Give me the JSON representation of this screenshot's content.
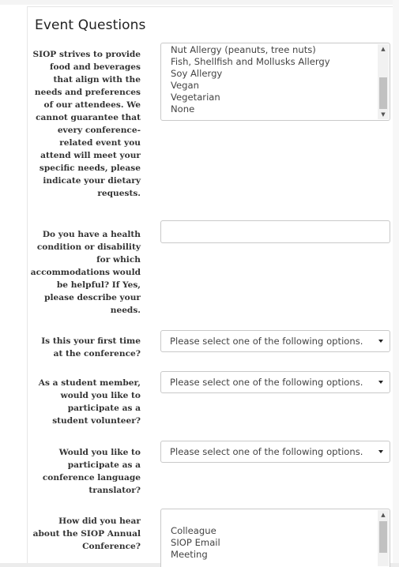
{
  "form": {
    "title": "Event Questions",
    "questions": {
      "dietary": {
        "label": "SIOP strives to provide food and beverages that align with the needs and preferences of our attendees. We cannot guarantee that every conference-related event you attend will meet your specific needs, please indicate your dietary requests.",
        "options": [
          "Nut Allergy (peanuts, tree nuts)",
          "Fish, Shellfish and Mollusks Allergy",
          "Soy Allergy",
          "Vegan",
          "Vegetarian",
          "None"
        ]
      },
      "health": {
        "label": "Do you have a health condition or disability for which accommodations would be helpful? If Yes, please describe your needs.",
        "value": ""
      },
      "first_time": {
        "label": "Is this your first time at the conference?",
        "selected": "Please select one of the following options."
      },
      "student_volunteer": {
        "label": "As a student member, would you like to participate as a student volunteer?",
        "selected": "Please select one of the following options."
      },
      "translator": {
        "label": "Would you like to participate as a conference language translator?",
        "selected": "Please select one of the following options."
      },
      "hear_about": {
        "label": "How did you hear about the SIOP Annual Conference?",
        "options": [
          "Colleague",
          "SIOP Email",
          "Meeting"
        ]
      }
    }
  },
  "icons": {
    "scroll_up": "triangle-up-icon",
    "scroll_down": "triangle-down-icon",
    "dropdown": "caret-down-icon"
  },
  "colors": {
    "border": "#c9c9c9",
    "text": "#333333",
    "scroll_thumb": "#c1c1c1"
  }
}
